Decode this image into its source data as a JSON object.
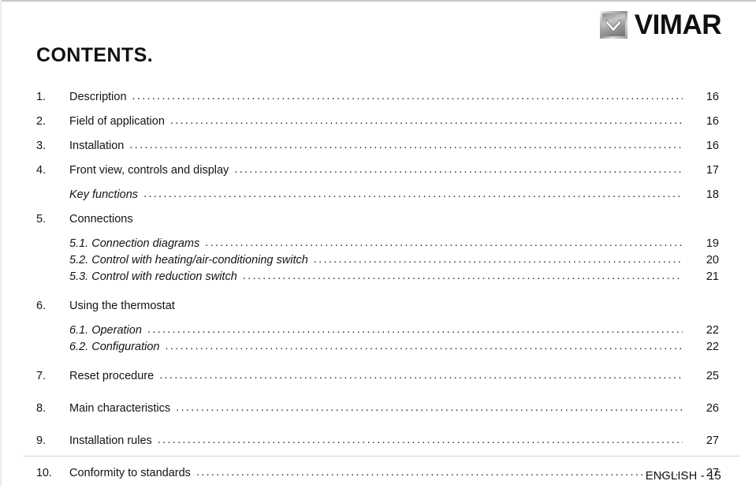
{
  "header": {
    "brand": "VIMAR",
    "logo_icon": "vimar-chevron-logo-icon"
  },
  "title": "CONTENTS.",
  "toc": {
    "leader": "........................................................................................................................................................",
    "entries": [
      {
        "num": "1.",
        "label": "Description",
        "page": "16",
        "level": 1,
        "leader": true
      },
      {
        "num": "2.",
        "label": "Field of application",
        "page": "16",
        "level": 1,
        "leader": true
      },
      {
        "num": "3.",
        "label": "Installation",
        "page": "16",
        "level": 1,
        "leader": true
      },
      {
        "num": "4.",
        "label": "Front view, controls and display",
        "page": "17",
        "level": 1,
        "leader": true
      },
      {
        "num": "",
        "label": "Key functions",
        "page": "18",
        "level": 2,
        "leader": true
      },
      {
        "num": "5.",
        "label": "Connections",
        "page": "",
        "level": 1,
        "leader": false
      },
      {
        "num": "5.1.",
        "label": "Connection diagrams",
        "page": "19",
        "level": 2,
        "leader": true
      },
      {
        "num": "5.2.",
        "label": "Control with heating/air-conditioning switch",
        "page": "20",
        "level": 2,
        "leader": true
      },
      {
        "num": "5.3.",
        "label": "Control with reduction switch",
        "page": "21",
        "level": 2,
        "leader": true
      },
      {
        "num": "6.",
        "label": "Using the thermostat",
        "page": "",
        "level": 1,
        "leader": false
      },
      {
        "num": "6.1.",
        "label": "Operation",
        "page": "22",
        "level": 2,
        "leader": true
      },
      {
        "num": "6.2.",
        "label": "Configuration",
        "page": "22",
        "level": 2,
        "leader": true
      },
      {
        "num": "7.",
        "label": "Reset procedure",
        "page": "25",
        "level": 1,
        "leader": true
      },
      {
        "num": "8.",
        "label": "Main characteristics",
        "page": "26",
        "level": 1,
        "leader": true
      },
      {
        "num": "9.",
        "label": "Installation rules",
        "page": "27",
        "level": 1,
        "leader": true
      },
      {
        "num": "10.",
        "label": "Conformity to standards",
        "page": "27",
        "level": 1,
        "leader": true
      }
    ]
  },
  "footer": {
    "page_label": "ENGLISH - 15"
  },
  "colors": {
    "text": "#141414",
    "rule": "#d2d2d2",
    "top_rule": "#c9c9c9"
  }
}
